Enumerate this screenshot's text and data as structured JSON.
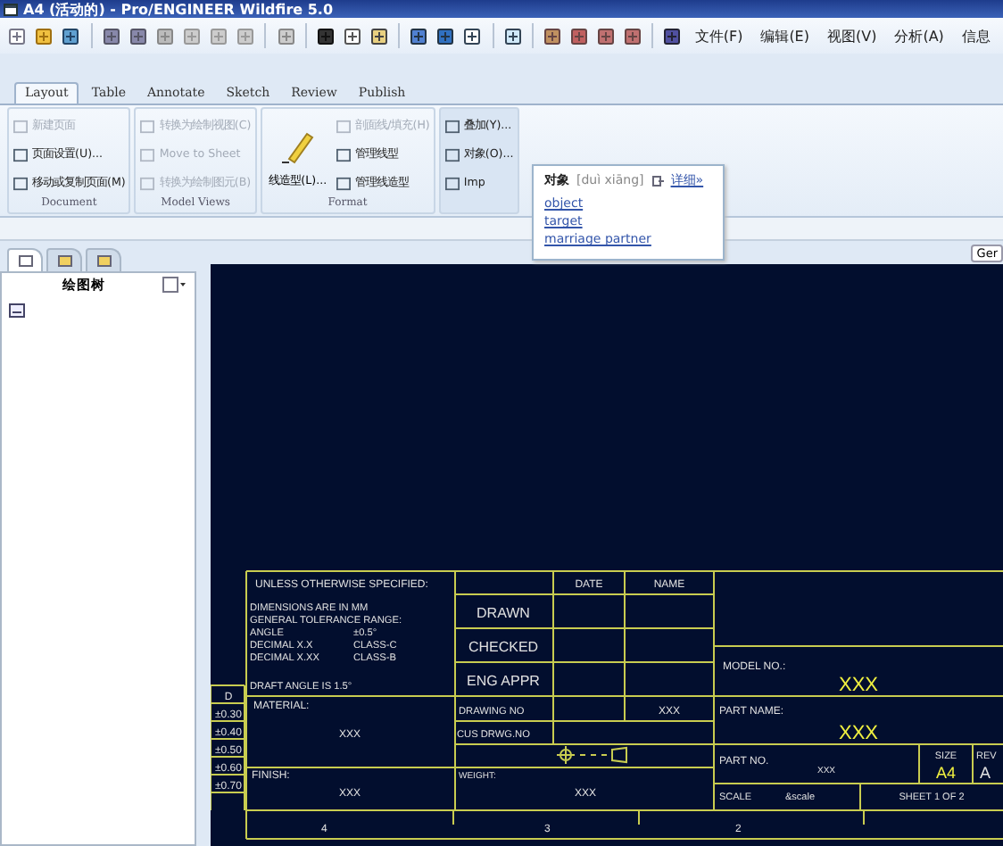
{
  "window": {
    "title": "A4 (活动的) - Pro/ENGINEER Wildfire 5.0"
  },
  "toolbar": {
    "menus": [
      "文件(F)",
      "编辑(E)",
      "视图(V)",
      "分析(A)",
      "信息"
    ]
  },
  "ribbon": {
    "tabs": [
      {
        "label": "Layout",
        "selected": true
      },
      {
        "label": "Table",
        "selected": false
      },
      {
        "label": "Annotate",
        "selected": false
      },
      {
        "label": "Sketch",
        "selected": false
      },
      {
        "label": "Review",
        "selected": false
      },
      {
        "label": "Publish",
        "selected": false
      }
    ],
    "groups": [
      {
        "label": "Document",
        "items": [
          {
            "label": "新建页面",
            "disabled": true
          },
          {
            "label": "页面设置(U)...",
            "disabled": false
          },
          {
            "label": "移动或复制页面(M)",
            "disabled": false
          }
        ]
      },
      {
        "label": "Model Views",
        "items": [
          {
            "label": "转换为绘制视图(C)",
            "disabled": true
          },
          {
            "label": "Move to Sheet",
            "disabled": true
          },
          {
            "label": "转换为绘制图元(B)",
            "disabled": true
          }
        ]
      },
      {
        "label": "Format",
        "big": {
          "label": "线造型(L)..."
        },
        "items": [
          {
            "label": "剖面线/填充(H)",
            "disabled": true
          },
          {
            "label": "管理线型",
            "disabled": false
          },
          {
            "label": "管理线造型",
            "disabled": false
          }
        ]
      },
      {
        "items": [
          {
            "label": "叠加(Y)...",
            "disabled": false
          },
          {
            "label": "对象(O)...",
            "disabled": false
          },
          {
            "label": "Imp",
            "disabled": false
          }
        ]
      }
    ]
  },
  "tooltip": {
    "word": "对象",
    "pinyin": "[duì xiāng]",
    "more": "详细»",
    "meanings": [
      "object",
      "target",
      "marriage partner"
    ]
  },
  "tree": {
    "tabs": [
      {
        "selected": true
      },
      {
        "selected": false
      },
      {
        "selected": false
      }
    ],
    "title": "绘图树"
  },
  "drawing": {
    "filter": "Ger",
    "title_block": {
      "unless": "UNLESS OTHERWISE SPECIFIED:",
      "date": "DATE",
      "name": "NAME",
      "notes": [
        "DIMENSIONS ARE IN MM",
        "GENERAL TOLERANCE RANGE:"
      ],
      "tolerances": [
        {
          "label": "ANGLE",
          "value": "±0.5°"
        },
        {
          "label": "DECIMAL X.X",
          "value": "CLASS-C"
        },
        {
          "label": "DECIMAL X.XX",
          "value": "CLASS-B"
        }
      ],
      "draft": "DRAFT ANGLE IS 1.5°",
      "signoffs": [
        "DRAWN",
        "CHECKED",
        "ENG APPR"
      ],
      "material_label": "MATERIAL:",
      "material": "XXX",
      "finish_label": "FINISH:",
      "finish": "XXX",
      "drawing_no_label": "DRAWING NO",
      "drawing_no": "XXX",
      "cus_drwg_label": "CUS DRWG.NO",
      "weight_label": "WEIGHT:",
      "weight": "XXX",
      "model_no_label": "MODEL NO.:",
      "model_no": "XXX",
      "part_name_label": "PART NAME:",
      "part_name": "XXX",
      "part_no_label": "PART NO.",
      "part_no": "XXX",
      "size_label": "SIZE",
      "size": "A4",
      "rev_label": "REV",
      "rev": "A",
      "scale_label": "SCALE",
      "scale": "&scale",
      "sheet": "SHEET 1  OF  2",
      "zones": [
        "4",
        "3",
        "2"
      ],
      "tolerance_table": [
        "D",
        "±0.30",
        "±0.40",
        "±0.50",
        "±0.60",
        "±0.70"
      ]
    }
  }
}
